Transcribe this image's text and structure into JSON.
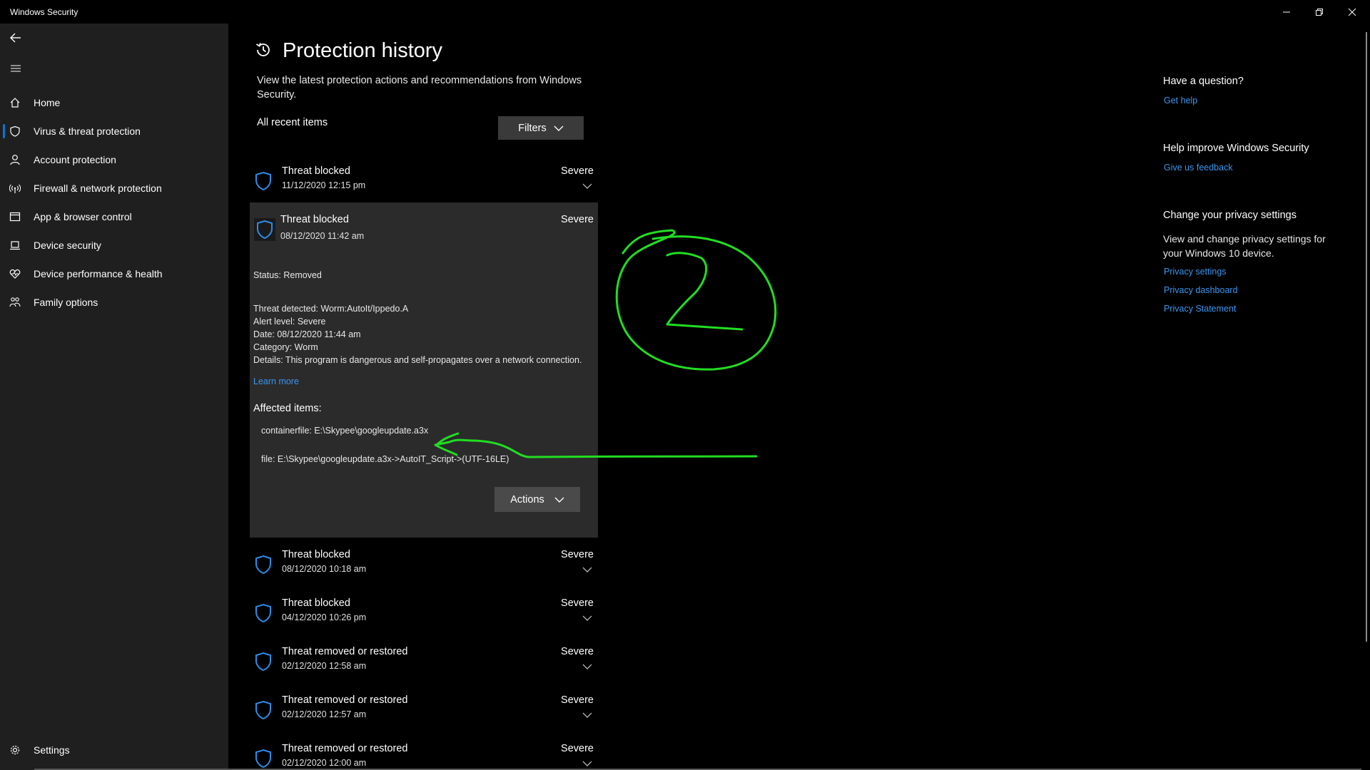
{
  "window": {
    "title": "Windows Security"
  },
  "sidebar": {
    "items": [
      {
        "label": "Home",
        "icon": "home-icon"
      },
      {
        "label": "Virus & threat protection",
        "icon": "shield-icon"
      },
      {
        "label": "Account protection",
        "icon": "person-icon"
      },
      {
        "label": "Firewall & network protection",
        "icon": "wifi-antenna-icon"
      },
      {
        "label": "App & browser control",
        "icon": "app-window-icon"
      },
      {
        "label": "Device security",
        "icon": "laptop-icon"
      },
      {
        "label": "Device performance & health",
        "icon": "heart-icon"
      },
      {
        "label": "Family options",
        "icon": "family-icon"
      }
    ],
    "settings_label": "Settings",
    "selected_index": 1,
    "accent_color": "#0a74d8"
  },
  "page": {
    "title": "Protection history",
    "intro": "View the latest protection actions and recommendations from Windows Security.",
    "recent_label": "All recent items",
    "filters_label": "Filters"
  },
  "history": [
    {
      "title": "Threat blocked",
      "date": "11/12/2020 12:15 pm",
      "severity": "Severe"
    },
    {
      "title": "Threat blocked",
      "date": "08/12/2020 11:42 am",
      "severity": "Severe"
    },
    {
      "title": "Threat blocked",
      "date": "08/12/2020 10:18 am",
      "severity": "Severe"
    },
    {
      "title": "Threat blocked",
      "date": "04/12/2020 10:26 pm",
      "severity": "Severe"
    },
    {
      "title": "Threat removed or restored",
      "date": "02/12/2020 12:58 am",
      "severity": "Severe"
    },
    {
      "title": "Threat removed or restored",
      "date": "02/12/2020 12:57 am",
      "severity": "Severe"
    },
    {
      "title": "Threat removed or restored",
      "date": "02/12/2020 12:00 am",
      "severity": "Severe"
    }
  ],
  "expanded": {
    "status": "Status: Removed",
    "threat_detected": "Threat detected:  Worm:AutoIt/Ippedo.A",
    "alert_level": "Alert level: Severe",
    "date": "Date:  08/12/2020 11:44 am",
    "category": "Category:  Worm",
    "details": "Details:  This program is dangerous and self-propagates over a network connection.",
    "learn_more": "Learn more",
    "affected_heading": "Affected items:",
    "affected_items": [
      "containerfile: E:\\Skypee\\googleupdate.a3x",
      "file: E:\\Skypee\\googleupdate.a3x->AutoIT_Script->(UTF-16LE)"
    ],
    "actions_label": "Actions"
  },
  "right_panel": {
    "question_heading": "Have a question?",
    "get_help": "Get help",
    "improve_heading": "Help improve Windows Security",
    "feedback": "Give us feedback",
    "privacy_heading": "Change your privacy settings",
    "privacy_text": "View and change privacy settings for your Windows 10 device.",
    "privacy_links": [
      "Privacy settings",
      "Privacy dashboard",
      "Privacy Statement"
    ],
    "link_color": "#3a96ef"
  },
  "annotation_color": "#22dd22"
}
